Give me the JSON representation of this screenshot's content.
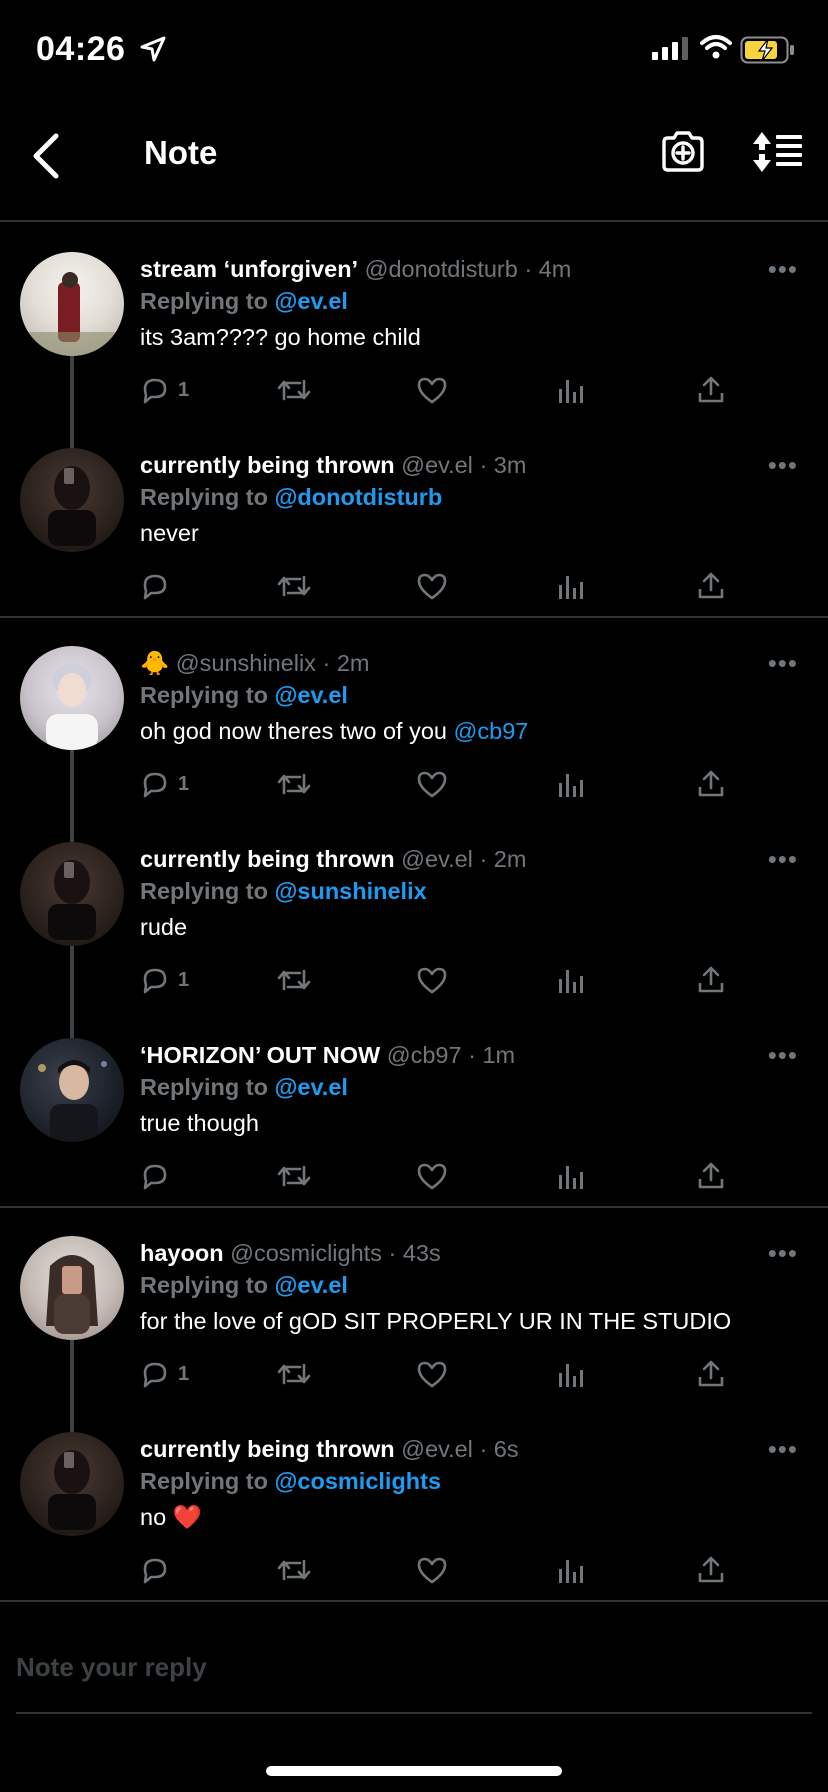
{
  "status_bar": {
    "time": "04:26"
  },
  "header": {
    "title": "Note"
  },
  "groups": [
    {
      "tweets": [
        {
          "name": "stream ‘unforgiven’",
          "handle": "@donotdisturb",
          "time": "4m",
          "replying_label": "Replying to",
          "replying_to": "@ev.el",
          "text": "its 3am???? go home child",
          "text_mention": "",
          "reply_count": "1"
        },
        {
          "name": "currently being thrown",
          "handle": "@ev.el",
          "time": "3m",
          "replying_label": "Replying to",
          "replying_to": "@donotdisturb",
          "text": "never",
          "text_mention": "",
          "reply_count": ""
        }
      ]
    },
    {
      "tweets": [
        {
          "name": "🐥",
          "handle": "@sunshinelix",
          "time": "2m",
          "replying_label": "Replying to",
          "replying_to": "@ev.el",
          "text": "oh god now theres two of you ",
          "text_mention": "@cb97",
          "reply_count": "1"
        },
        {
          "name": "currently being thrown",
          "handle": "@ev.el",
          "time": "2m",
          "replying_label": "Replying to",
          "replying_to": "@sunshinelix",
          "text": "rude",
          "text_mention": "",
          "reply_count": "1"
        },
        {
          "name": "‘HORIZON’ OUT NOW",
          "handle": "@cb97",
          "time": "1m",
          "replying_label": "Replying to",
          "replying_to": "@ev.el",
          "text": "true though",
          "text_mention": "",
          "reply_count": ""
        }
      ]
    },
    {
      "tweets": [
        {
          "name": "hayoon",
          "handle": "@cosmiclights",
          "time": "43s",
          "replying_label": "Replying to",
          "replying_to": "@ev.el",
          "text": "for the love of gOD SIT PROPERLY UR IN THE STUDIO",
          "text_mention": "",
          "reply_count": "1"
        },
        {
          "name": "currently being thrown",
          "handle": "@ev.el",
          "time": "6s",
          "replying_label": "Replying to",
          "replying_to": "@cosmiclights",
          "text": "no ❤️",
          "text_mention": "",
          "reply_count": ""
        }
      ]
    }
  ],
  "compose": {
    "placeholder": "Note your reply"
  },
  "colors": {
    "accent": "#1d9bf0",
    "muted": "#71767b",
    "divider": "#2f3336",
    "background": "#000000"
  }
}
